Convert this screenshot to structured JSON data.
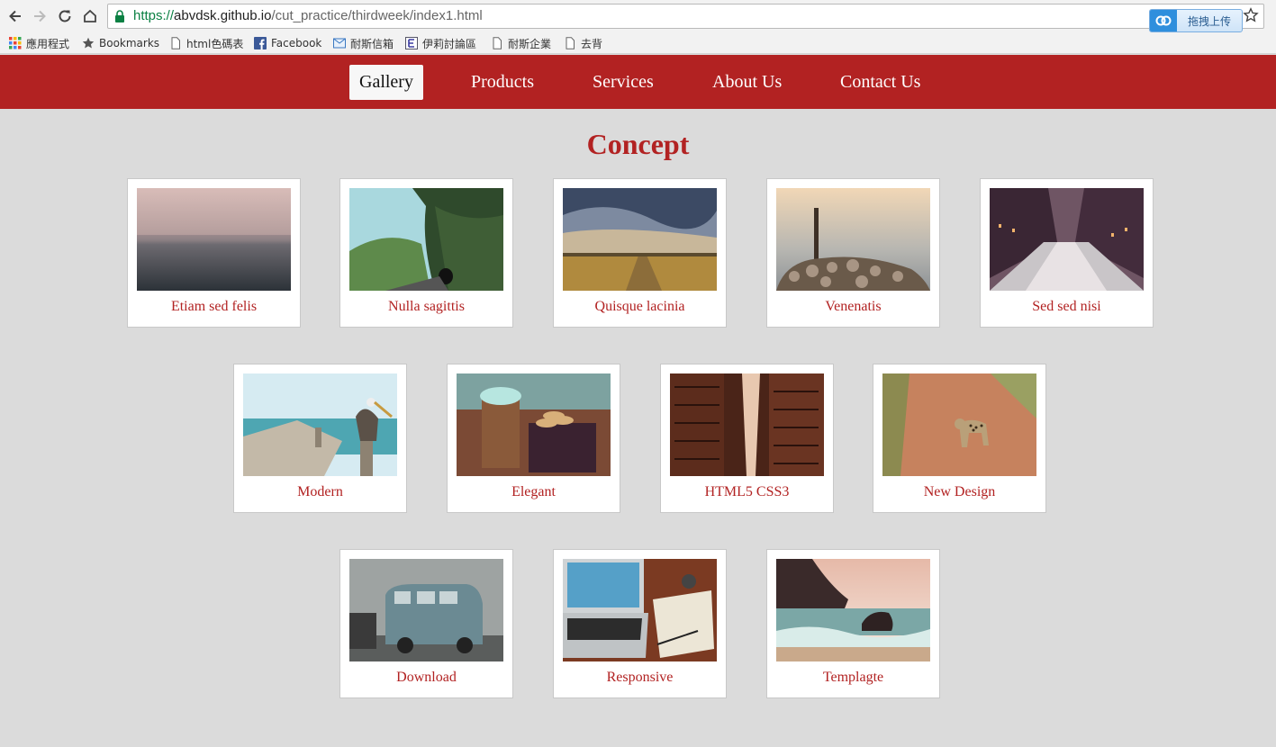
{
  "browser": {
    "url_scheme": "https://",
    "url_host": "abvdsk.github.io",
    "url_path": "/cut_practice/thirdweek/index1.html",
    "extension_button": "拖拽上传",
    "bookmarks": [
      {
        "label": "應用程式",
        "icon": "apps-grid-icon"
      },
      {
        "label": "Bookmarks",
        "icon": "star-icon"
      },
      {
        "label": "html色碼表",
        "icon": "page-icon"
      },
      {
        "label": "Facebook",
        "icon": "facebook-icon"
      },
      {
        "label": "耐斯信箱",
        "icon": "mail-icon"
      },
      {
        "label": "伊莉討論區",
        "icon": "e-forum-icon"
      },
      {
        "label": "耐斯企業",
        "icon": "page-icon"
      },
      {
        "label": "去背",
        "icon": "page-icon"
      }
    ]
  },
  "nav": {
    "items": [
      "Gallery",
      "Products",
      "Services",
      "About Us",
      "Contact Us"
    ],
    "active": "Gallery"
  },
  "page": {
    "title": "Concept"
  },
  "gallery": [
    {
      "caption": "Etiam sed felis",
      "scene": "misty-sea"
    },
    {
      "caption": "Nulla sagittis",
      "scene": "mountain-tunnel-road"
    },
    {
      "caption": "Quisque lacinia",
      "scene": "grass-field-sky"
    },
    {
      "caption": "Venenatis",
      "scene": "pole-stones-lake"
    },
    {
      "caption": "Sed sed nisi",
      "scene": "city-canal"
    },
    {
      "caption": "Modern",
      "scene": "pier-pelicans"
    },
    {
      "caption": "Elegant",
      "scene": "coffee-cookies"
    },
    {
      "caption": "HTML5 CSS3",
      "scene": "fire-escapes"
    },
    {
      "caption": "New Design",
      "scene": "leopard-dirt-road"
    },
    {
      "caption": "Download",
      "scene": "vintage-van"
    },
    {
      "caption": "Responsive",
      "scene": "laptop-notebook"
    },
    {
      "caption": "Templagte",
      "scene": "rocky-shore-waves"
    }
  ],
  "colors": {
    "brand_red": "#b22222",
    "page_bg": "#dbdbdb",
    "card_bg": "#ffffff"
  }
}
